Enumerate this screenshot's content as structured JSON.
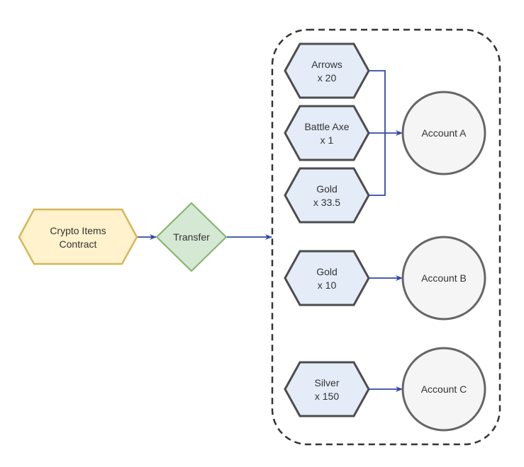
{
  "colors": {
    "contract_fill": "#fff2cc",
    "contract_stroke": "#d6b656",
    "transfer_fill": "#d5e8d4",
    "transfer_stroke": "#82b366",
    "item_fill": "#e3ecf7",
    "item_stroke": "#4d4d4d",
    "account_fill": "#f5f5f5",
    "account_stroke": "#666666",
    "connector": "#2f49a8"
  },
  "contract": {
    "line1": "Crypto Items",
    "line2": "Contract"
  },
  "transfer": {
    "label": "Transfer"
  },
  "items": [
    {
      "line1": "Arrows",
      "line2": "x 20",
      "account": "Account A"
    },
    {
      "line1": "Battle Axe",
      "line2": "x 1",
      "account": "Account A"
    },
    {
      "line1": "Gold",
      "line2": "x 33.5",
      "account": "Account A"
    },
    {
      "line1": "Gold",
      "line2": "x 10",
      "account": "Account B"
    },
    {
      "line1": "Silver",
      "line2": "x 150",
      "account": "Account C"
    }
  ],
  "accounts": [
    {
      "label": "Account A"
    },
    {
      "label": "Account B"
    },
    {
      "label": "Account C"
    }
  ]
}
